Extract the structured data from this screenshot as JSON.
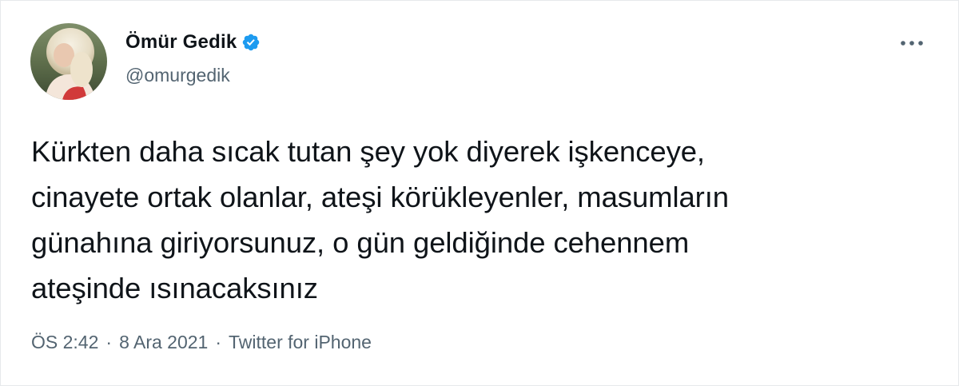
{
  "author": {
    "display_name": "Ömür Gedik",
    "handle": "@omurgedik",
    "verified": true
  },
  "tweet": {
    "text": "Kürkten daha sıcak tutan şey yok diyerek işkenceye,\ncinayete ortak olanlar, ateşi körükleyenler, masumların\ngünahına giriyorsunuz, o gün geldiğinde cehennem\nateşinde ısınacaksınız"
  },
  "meta": {
    "time": "ÖS 2:42",
    "date": "8 Ara 2021",
    "source": "Twitter for iPhone",
    "separator": "·"
  },
  "icons": {
    "verified": "verified-badge-icon",
    "more": "more-options-icon"
  },
  "colors": {
    "text": "#0f1419",
    "secondary": "#536471",
    "verified_blue": "#1d9bf0",
    "background": "#ffffff"
  }
}
